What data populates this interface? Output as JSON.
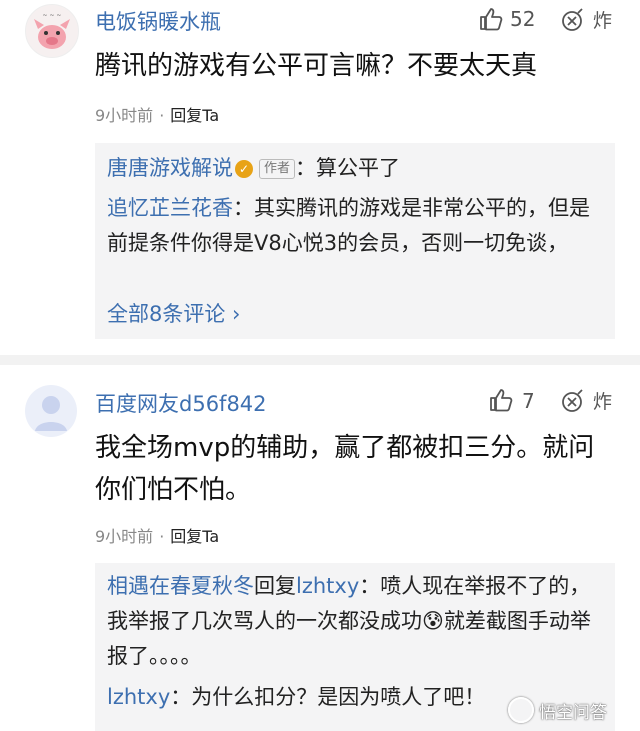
{
  "comments": [
    {
      "username": "电饭锅暖水瓶",
      "like_count": "52",
      "ban_label": "炸",
      "text": "腾讯的游戏有公平可言嘛？不要太天真",
      "time": "9小时前",
      "separator": "·",
      "reply_label": "回复Ta",
      "replies": {
        "r1_name": "唐唐游戏解说",
        "r1_badge": "✓",
        "r1_tag": "作者",
        "r1_colon": "：",
        "r1_text": "算公平了",
        "r2_name": "追忆芷兰花香",
        "r2_colon": "：",
        "r2_text": "其实腾讯的游戏是非常公平的，但是前提条件你得是V8心悦3的会员，否则一切免谈，",
        "view_all": "全部8条评论 ›"
      }
    },
    {
      "username": "百度网友d56f842",
      "like_count": "7",
      "ban_label": "炸",
      "text": "我全场mvp的辅助，赢了都被扣三分。就问你们怕不怕。",
      "time": "9小时前",
      "separator": "·",
      "reply_label": "回复Ta",
      "replies": {
        "r1_name": "相遇在春夏秋冬",
        "r1_mid": "回复",
        "r1_target": "lzhtxy",
        "r1_colon": "：",
        "r1_text": "喷人现在举报不了的，我举报了几次骂人的一次都没成功😰就差截图手动举报了。。。。",
        "r2_name": "lzhtxy",
        "r2_colon": "：",
        "r2_text": "为什么扣分？是因为喷人了吧！"
      }
    }
  ],
  "watermark": "悟空问答",
  "colors": {
    "username": "#3d6fb0",
    "reply_box": "#f4f4f5",
    "meta": "#888888"
  },
  "icons": [
    "avatar-1",
    "thumbs-up-icon",
    "bomb-icon",
    "verified-icon",
    "chevron-right-icon",
    "avatar-2"
  ]
}
